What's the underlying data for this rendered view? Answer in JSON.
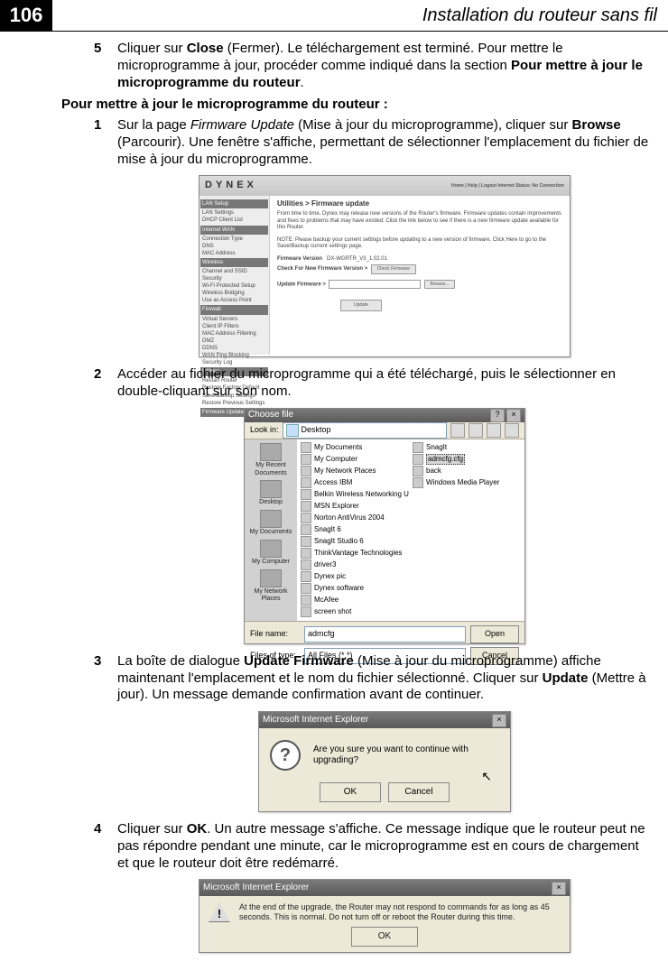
{
  "header": {
    "page_number": "106",
    "title": "Installation du routeur sans fil"
  },
  "step5": {
    "num": "5",
    "pre": "Cliquer sur ",
    "close": "Close",
    "mid1": " (Fermer). Le téléchargement est terminé. Pour mettre le microprogramme à jour, procéder comme indiqué dans la section ",
    "bold_section": "Pour mettre à jour le microprogramme du routeur",
    "end": "."
  },
  "subheading": "Pour mettre à jour le microprogramme du routeur :",
  "step1": {
    "num": "1",
    "pre": "Sur la page ",
    "ital": "Firmware Update",
    "mid1": " (Mise à jour du microprogramme), cliquer sur ",
    "browse": "Browse",
    "post": " (Parcourir). Une fenêtre s'affiche, permettant de sélectionner l'emplacement du fichier de mise à jour du microprogramme."
  },
  "firmware": {
    "brand": "DYNEX",
    "top_right": "Home | Help | Logout   Internet Status:  No Connection",
    "title": "Utilities > Firmware update",
    "desc1": "From time to time, Dynex may release new versions of the Router's firmware. Firmware updates contain improvements and fixes to problems that may have existed. Click the link below to see if there is a new firmware update available for this Router.",
    "note": "NOTE: Please backup your current settings before updating to a new version of firmware. Click Here to go to the Save/Backup current settings page.",
    "row_version_lbl": "Firmware Version",
    "row_version_val": "DX-WGRTR_V3_1.02.01",
    "row_check_lbl": "Check For New Firmware Version >",
    "row_check_btn": "Check Firmware",
    "row_update_lbl": "Update Firmware >",
    "row_update_browse": "Browse...",
    "row_update_btn": "Update",
    "sidebar": {
      "s1": "LAN Setup",
      "i1": "LAN Settings",
      "i2": "DHCP Client List",
      "s2": "Internet WAN",
      "i3": "Connection Type",
      "i4": "DNS",
      "i5": "MAC Address",
      "s3": "Wireless",
      "i6": "Channel and SSID",
      "i7": "Security",
      "i8": "Wi-Fi Protected Setup",
      "i9": "Wireless Bridging",
      "i10": "Use as Access Point",
      "s4": "Firewall",
      "i11": "Virtual Servers",
      "i12": "Client IP Filters",
      "i13": "MAC Address Filtering",
      "i14": "DMZ",
      "i15": "DDNS",
      "i16": "WAN Ping Blocking",
      "i17": "Security Log",
      "s5": "Utilities",
      "i18": "Restart Router",
      "i19": "Restore Factory Default",
      "i20": "Save/Backup Settings",
      "i21": "Restore Previous Settings",
      "i22": "Firmware Update"
    }
  },
  "step2": {
    "num": "2",
    "text": "Accéder au fichier du microprogramme qui a été téléchargé, puis le sélectionner en double-cliquant sur son nom."
  },
  "choose": {
    "title": "Choose file",
    "lookin_lbl": "Look in:",
    "lookin_val": "Desktop",
    "places": {
      "p1": "My Recent Documents",
      "p2": "Desktop",
      "p3": "My Documents",
      "p4": "My Computer",
      "p5": "My Network Places"
    },
    "files_left": [
      "My Documents",
      "My Computer",
      "My Network Places",
      "Access IBM",
      "Belkin Wireless Networking Utility",
      "MSN Explorer",
      "Norton AntiVirus 2004",
      "SnagIt 6",
      "SnagIt Studio 6",
      "ThinkVantage Technologies",
      "driver3",
      "Dynex pic",
      "Dynex software",
      "McAfee",
      "screen shot"
    ],
    "files_right": [
      "SnagIt",
      "admcfg.cfg",
      "back",
      "Windows Media Player"
    ],
    "filename_lbl": "File name:",
    "filename_val": "admcfg",
    "filetype_lbl": "Files of type:",
    "filetype_val": "All Files (*.*)",
    "open_btn": "Open",
    "cancel_btn": "Cancel"
  },
  "step3": {
    "num": "3",
    "pre": "La boîte de dialogue ",
    "b1": "Update Firmware",
    "mid1": " (Mise à jour du microprogramme) affiche maintenant l'emplacement et le nom du fichier sélectionné. Cliquer sur ",
    "b2": "Update",
    "post": " (Mettre à jour). Un message demande confirmation avant de continuer."
  },
  "confirm": {
    "title": "Microsoft Internet Explorer",
    "msg": "Are you sure you want to continue with upgrading?",
    "ok": "OK",
    "cancel": "Cancel"
  },
  "step4": {
    "num": "4",
    "pre": "Cliquer sur ",
    "b1": "OK",
    "post": ". Un autre message s'affiche. Ce message indique que le routeur peut ne pas répondre pendant une minute, car le microprogramme est en cours de chargement et que le routeur doit être redémarré."
  },
  "alert2": {
    "title": "Microsoft Internet Explorer",
    "msg": "At the end of the upgrade, the Router may not respond to commands for as long as 45 seconds. This is normal. Do not turn off or reboot the Router during this time.",
    "ok": "OK"
  }
}
